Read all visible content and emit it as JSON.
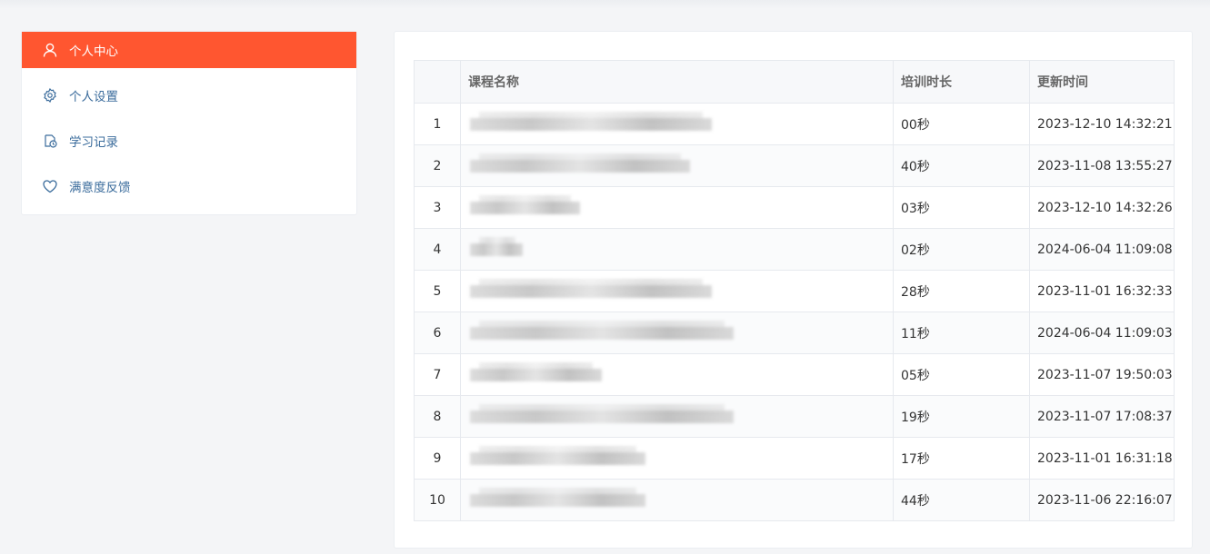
{
  "sidebar": {
    "items": [
      {
        "label": "个人中心",
        "icon": "user-icon",
        "active": true
      },
      {
        "label": "个人设置",
        "icon": "gear-icon",
        "active": false
      },
      {
        "label": "学习记录",
        "icon": "history-icon",
        "active": false
      },
      {
        "label": "满意度反馈",
        "icon": "heart-icon",
        "active": false
      }
    ]
  },
  "table": {
    "headers": {
      "index": "",
      "name": "课程名称",
      "duration": "培训时长",
      "updated": "更新时间"
    },
    "rows": [
      {
        "index": "1",
        "duration": "00秒",
        "updated": "2023-12-10 14:32:21",
        "name_blur": 0.55
      },
      {
        "index": "2",
        "duration": "40秒",
        "updated": "2023-11-08 13:55:27",
        "name_blur": 0.5
      },
      {
        "index": "3",
        "duration": "03秒",
        "updated": "2023-12-10 14:32:26",
        "name_blur": 0.25
      },
      {
        "index": "4",
        "duration": "02秒",
        "updated": "2024-06-04 11:09:08",
        "name_blur": 0.12
      },
      {
        "index": "5",
        "duration": "28秒",
        "updated": "2023-11-01 16:32:33",
        "name_blur": 0.55
      },
      {
        "index": "6",
        "duration": "11秒",
        "updated": "2024-06-04 11:09:03",
        "name_blur": 0.6
      },
      {
        "index": "7",
        "duration": "05秒",
        "updated": "2023-11-07 19:50:03",
        "name_blur": 0.3
      },
      {
        "index": "8",
        "duration": "19秒",
        "updated": "2023-11-07 17:08:37",
        "name_blur": 0.6
      },
      {
        "index": "9",
        "duration": "17秒",
        "updated": "2023-11-01 16:31:18",
        "name_blur": 0.4
      },
      {
        "index": "10",
        "duration": "44秒",
        "updated": "2023-11-06 22:16:07",
        "name_blur": 0.4
      }
    ]
  },
  "colors": {
    "accent": "#ff5630",
    "sidebar_text": "#3b6c9c"
  }
}
